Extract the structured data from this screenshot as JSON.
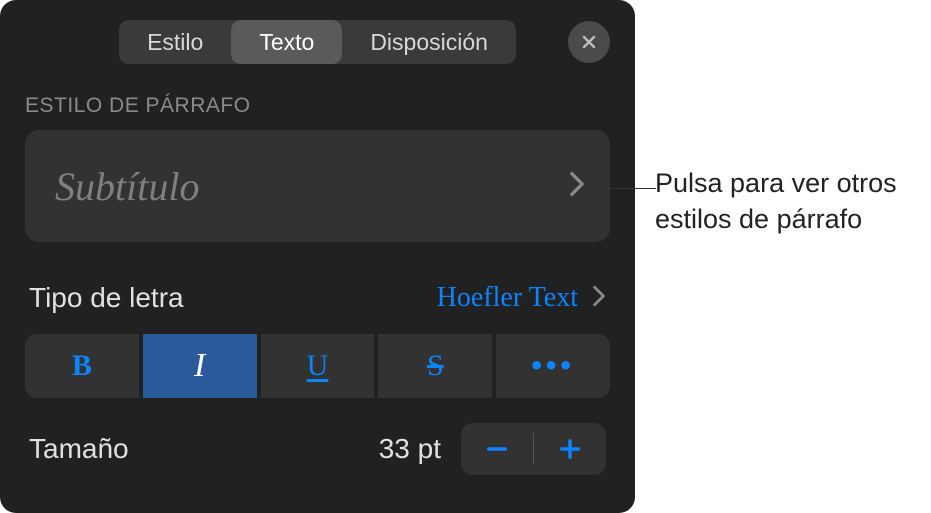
{
  "tabs": {
    "style": "Estilo",
    "text": "Texto",
    "layout": "Disposición"
  },
  "paragraph_style": {
    "section_label": "ESTILO DE PÁRRAFO",
    "current": "Subtítulo"
  },
  "font": {
    "label": "Tipo de letra",
    "value": "Hoefler Text"
  },
  "format_buttons": {
    "bold": "B",
    "italic": "I",
    "underline": "U",
    "strike": "S",
    "more": "•••"
  },
  "size": {
    "label": "Tamaño",
    "value": "33 pt"
  },
  "callout": {
    "text": "Pulsa para ver otros estilos de párrafo"
  }
}
